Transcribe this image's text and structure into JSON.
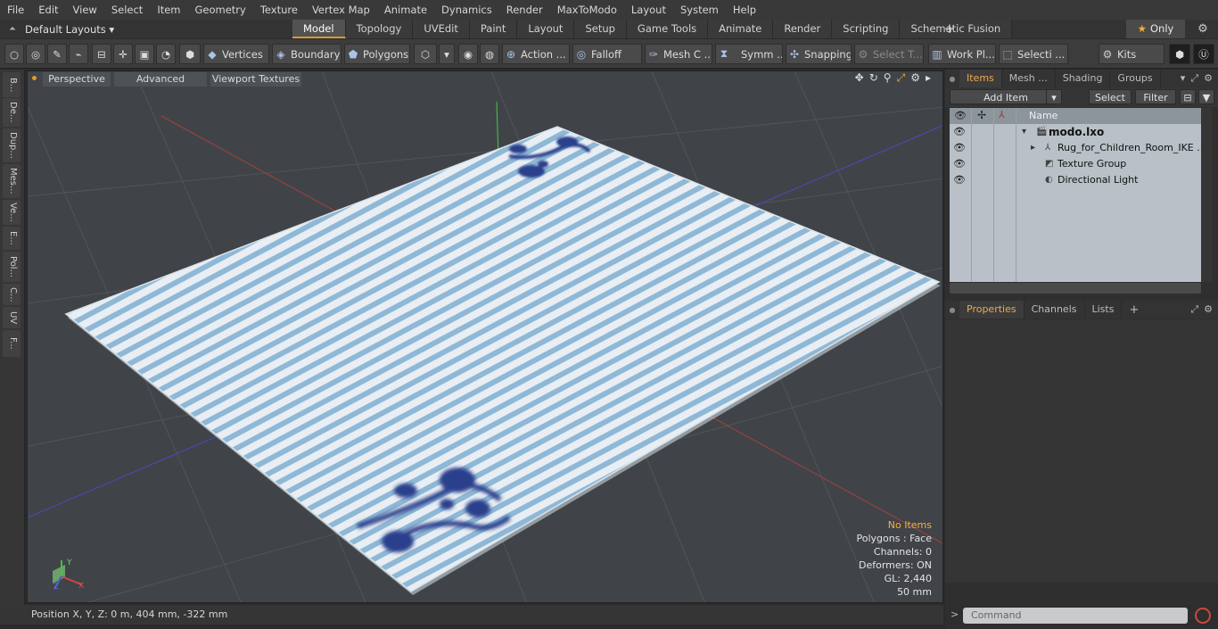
{
  "menu": [
    "File",
    "Edit",
    "View",
    "Select",
    "Item",
    "Geometry",
    "Texture",
    "Vertex Map",
    "Animate",
    "Dynamics",
    "Render",
    "MaxToModo",
    "Layout",
    "System",
    "Help"
  ],
  "layouts": {
    "label": "Default Layouts ▾"
  },
  "tabs": [
    {
      "label": "Model",
      "active": true
    },
    {
      "label": "Topology",
      "active": false
    },
    {
      "label": "UVEdit",
      "active": false
    },
    {
      "label": "Paint",
      "active": false
    },
    {
      "label": "Layout",
      "active": false
    },
    {
      "label": "Setup",
      "active": false
    },
    {
      "label": "Game Tools",
      "active": false
    },
    {
      "label": "Animate",
      "active": false
    },
    {
      "label": "Render",
      "active": false
    },
    {
      "label": "Scripting",
      "active": false
    },
    {
      "label": "Schematic Fusion",
      "active": false
    }
  ],
  "only_label": "Only",
  "toolbar": {
    "vertices": "Vertices",
    "boundary": "Boundary",
    "polygons": "Polygons",
    "action": "Action ...",
    "falloff": "Falloff",
    "mesh_c": "Mesh C ...",
    "symm": "Symm ...",
    "snapping": "Snapping",
    "select_t": "Select T...",
    "work_pl": "Work Pl...",
    "selecti": "Selecti ...",
    "kits": "Kits"
  },
  "left_strip": [
    "B...",
    "De...",
    "Dup...",
    "Mes...",
    "Ve...",
    "E...",
    "Pol...",
    "C...",
    "UV",
    "F..."
  ],
  "viewport": {
    "perspective": "Perspective",
    "advanced": "Advanced",
    "viewport_textures": "Viewport Textures",
    "info": {
      "no_items": "No Items",
      "polygons": "Polygons : Face",
      "channels": "Channels: 0",
      "deformers": "Deformers: ON",
      "gl": "GL: 2,440",
      "scale": "50 mm"
    },
    "axes": {
      "x": "X",
      "y": "Y",
      "z": "Z"
    }
  },
  "status": {
    "position": "Position X, Y, Z:   0 m, 404 mm, -322 mm"
  },
  "right_panel": {
    "top_tabs": [
      "Items",
      "Mesh ...",
      "Shading",
      "Groups"
    ],
    "add_item": "Add Item",
    "select": "Select",
    "filter": "Filter",
    "name_col": "Name",
    "tree": [
      {
        "label": "modo.lxo",
        "bold": true
      },
      {
        "label": "Rug_for_Children_Room_IKE ..."
      },
      {
        "label": "Texture Group"
      },
      {
        "label": "Directional Light"
      }
    ],
    "bottom_tabs": [
      "Properties",
      "Channels",
      "Lists"
    ],
    "command_placeholder": "Command",
    "prompt": ">"
  },
  "colors": {
    "accent": "#e09a2a",
    "info_warning": "#f2b33d",
    "tree_bg": "#b9c0c7",
    "rug_stripe": "#8fb8d6"
  }
}
